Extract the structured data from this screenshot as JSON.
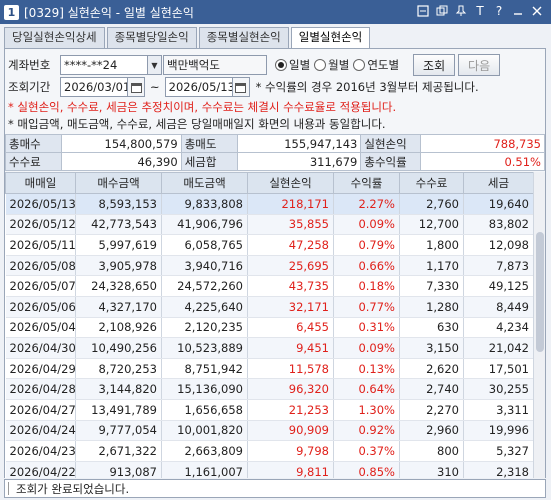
{
  "window": {
    "number": "1",
    "title": "[0329] 실현손익 - 일별 실현손익",
    "controls": [
      "icon1",
      "icon2",
      "icon3",
      "T",
      "?",
      "-",
      "x"
    ]
  },
  "tabs": [
    {
      "label": "당일실현손익상세"
    },
    {
      "label": "종목별당일손익"
    },
    {
      "label": "종목별실현손익"
    },
    {
      "label": "일별실현손익"
    }
  ],
  "account": {
    "label": "계좌번호",
    "number": "****-**24",
    "name": "백만백억도"
  },
  "period_options": [
    {
      "label": "일별",
      "selected": true
    },
    {
      "label": "월별",
      "selected": false
    },
    {
      "label": "연도별",
      "selected": false
    }
  ],
  "buttons": {
    "search": "조회",
    "next": "다음"
  },
  "query": {
    "label": "조회기간",
    "from": "2026/03/01",
    "tilde": "~",
    "to": "2026/05/13",
    "info": "* 수익률의 경우 2016년 3월부터 제공됩니다."
  },
  "notes": {
    "red": "* 실현손익, 수수료, 세금은 추정치이며, 수수료는 체결시 수수료율로 적용됩니다.",
    "black": "* 매입금액, 매도금액, 수수료, 세금은 당일매매일지 화면의 내용과 동일합니다."
  },
  "summary": {
    "total_buy_label": "총매수",
    "total_buy": "154,800,579",
    "total_sell_label": "총매도",
    "total_sell": "155,947,143",
    "realized_label": "실현손익",
    "realized": "788,735",
    "fee_label": "수수료",
    "fee": "46,390",
    "tax_label": "세금합",
    "tax": "311,679",
    "return_label": "총수익률",
    "return": "0.51%"
  },
  "grid": {
    "columns": [
      "매매일",
      "매수금액",
      "매도금액",
      "실현손익",
      "수익률",
      "수수료",
      "세금"
    ],
    "rows": [
      [
        "2026/05/13",
        "8,593,153",
        "9,833,808",
        "218,171",
        "2.27%",
        "2,760",
        "19,640"
      ],
      [
        "2026/05/12",
        "42,773,543",
        "41,906,796",
        "35,855",
        "0.09%",
        "12,700",
        "83,802"
      ],
      [
        "2026/05/11",
        "5,997,619",
        "6,058,765",
        "47,258",
        "0.79%",
        "1,800",
        "12,098"
      ],
      [
        "2026/05/08",
        "3,905,978",
        "3,940,716",
        "25,695",
        "0.66%",
        "1,170",
        "7,873"
      ],
      [
        "2026/05/07",
        "24,328,650",
        "24,572,260",
        "43,735",
        "0.18%",
        "7,330",
        "49,125"
      ],
      [
        "2026/05/06",
        "4,327,170",
        "4,225,640",
        "32,171",
        "0.77%",
        "1,280",
        "8,449"
      ],
      [
        "2026/05/04",
        "2,108,926",
        "2,120,235",
        "6,455",
        "0.31%",
        "630",
        "4,234"
      ],
      [
        "2026/04/30",
        "10,490,256",
        "10,523,889",
        "9,451",
        "0.09%",
        "3,150",
        "21,042"
      ],
      [
        "2026/04/29",
        "8,720,253",
        "8,751,942",
        "11,578",
        "0.13%",
        "2,620",
        "17,501"
      ],
      [
        "2026/04/28",
        "3,144,820",
        "15,136,090",
        "96,320",
        "0.64%",
        "2,740",
        "30,255"
      ],
      [
        "2026/04/27",
        "13,491,789",
        "1,656,658",
        "21,253",
        "1.30%",
        "2,270",
        "3,311"
      ],
      [
        "2026/04/24",
        "9,777,054",
        "10,001,820",
        "90,909",
        "0.92%",
        "2,960",
        "19,996"
      ],
      [
        "2026/04/23",
        "2,671,322",
        "2,663,809",
        "9,798",
        "0.37%",
        "800",
        "5,327"
      ],
      [
        "2026/04/22",
        "913,087",
        "1,161,007",
        "9,811",
        "0.85%",
        "310",
        "2,318"
      ],
      [
        "2026/04/21",
        "1,462,218",
        "1,155,344",
        "13,394",
        "1.18%",
        "390",
        "2,306"
      ]
    ]
  },
  "status": {
    "text": "조회가 완료되었습니다."
  },
  "colors": {
    "positive": "#e0201a",
    "titlebar": "#3a5f96",
    "header": "#dbe4ef"
  }
}
